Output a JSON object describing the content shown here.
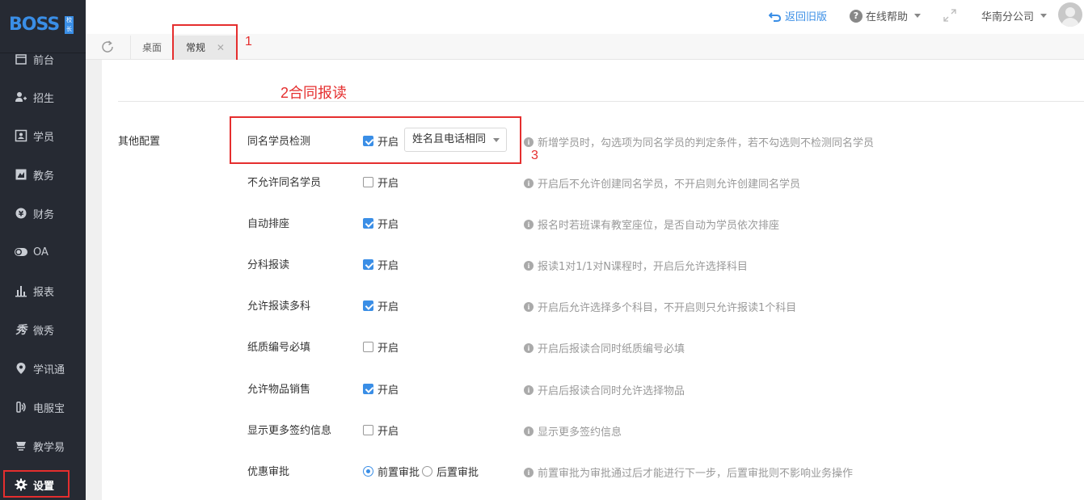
{
  "app": {
    "logo_text": "BOSS",
    "logo_badge": "校长"
  },
  "sidebar": {
    "items": [
      {
        "label": "前台",
        "icon": "calendar-icon"
      },
      {
        "label": "招生",
        "icon": "user-plus-icon"
      },
      {
        "label": "学员",
        "icon": "id-card-icon"
      },
      {
        "label": "教务",
        "icon": "book-icon"
      },
      {
        "label": "财务",
        "icon": "yen-icon"
      },
      {
        "label": "OA",
        "icon": "toggle-icon"
      },
      {
        "label": "报表",
        "icon": "bar-chart-icon"
      },
      {
        "label": "微秀",
        "icon": "xiu-icon"
      },
      {
        "label": "学讯通",
        "icon": "location-pin-icon"
      },
      {
        "label": "电服宝",
        "icon": "phone-icon"
      },
      {
        "label": "教学易",
        "icon": "teach-icon"
      },
      {
        "label": "设置",
        "icon": "gear-icon"
      }
    ]
  },
  "header": {
    "back_old": "返回旧版",
    "help": "在线帮助",
    "branch": "华南分公司"
  },
  "tabs": {
    "items": [
      {
        "label": "桌面"
      },
      {
        "label": "常规"
      }
    ]
  },
  "annotations": {
    "n1": "1",
    "n2": "2合同报读",
    "n3": "3"
  },
  "content": {
    "group_label": "其他配置",
    "rows": [
      {
        "label": "同名学员检测",
        "control": "checkbox",
        "checked": true,
        "option": "开启",
        "select_value": "姓名且电话相同",
        "hint": "新增学员时，勾选项为同名学员的判定条件，若不勾选则不检测同名学员"
      },
      {
        "label": "不允许同名学员",
        "control": "checkbox",
        "checked": false,
        "option": "开启",
        "hint": "开启后不允许创建同名学员，不开启则允许创建同名学员"
      },
      {
        "label": "自动排座",
        "control": "checkbox",
        "checked": true,
        "option": "开启",
        "hint": "报名时若班课有教室座位，是否自动为学员依次排座"
      },
      {
        "label": "分科报读",
        "control": "checkbox",
        "checked": true,
        "option": "开启",
        "hint": "报读1对1/1对N课程时，开启后允许选择科目"
      },
      {
        "label": "允许报读多科",
        "control": "checkbox",
        "checked": true,
        "option": "开启",
        "hint": "开启后允许选择多个科目，不开启则只允许报读1个科目"
      },
      {
        "label": "纸质编号必填",
        "control": "checkbox",
        "checked": false,
        "option": "开启",
        "hint": "开启后报读合同时纸质编号必填"
      },
      {
        "label": "允许物品销售",
        "control": "checkbox",
        "checked": true,
        "option": "开启",
        "hint": "开启后报读合同时允许选择物品"
      },
      {
        "label": "显示更多签约信息",
        "control": "checkbox",
        "checked": false,
        "option": "开启",
        "hint": "显示更多签约信息"
      },
      {
        "label": "优惠审批",
        "control": "radio",
        "options": [
          "前置审批",
          "后置审批"
        ],
        "selected": 0,
        "hint": "前置审批为审批通过后才能进行下一步，后置审批则不影响业务操作"
      }
    ]
  },
  "colors": {
    "accent": "#3a8ee6",
    "sidebar_bg": "#262a33",
    "annotation_red": "#e52e2e"
  }
}
